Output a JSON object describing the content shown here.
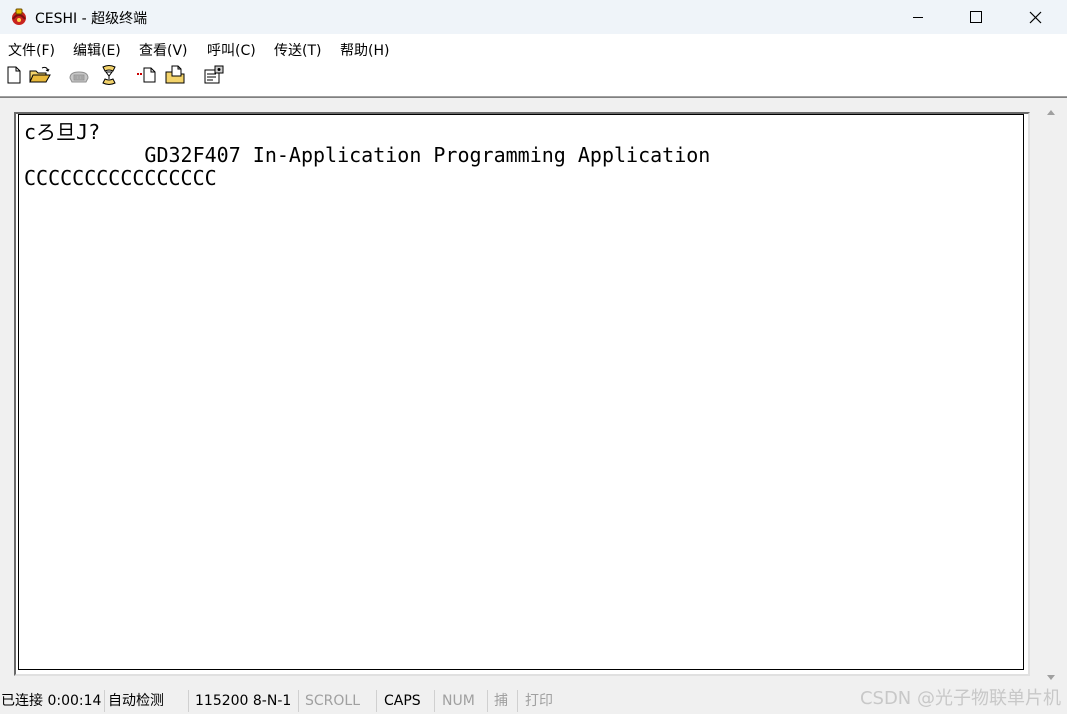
{
  "window": {
    "title": "CESHI - 超级终端"
  },
  "title_buttons": {
    "minimize": "minimize-icon",
    "maximize": "maximize-icon",
    "close": "close-icon"
  },
  "menu": {
    "items": [
      {
        "label": "文件(F)"
      },
      {
        "label": "编辑(E)"
      },
      {
        "label": "查看(V)"
      },
      {
        "label": "呼叫(C)"
      },
      {
        "label": "传送(T)"
      },
      {
        "label": "帮助(H)"
      }
    ]
  },
  "toolbar": {
    "buttons": [
      {
        "icon": "new-document-icon"
      },
      {
        "icon": "open-folder-icon"
      },
      {
        "icon": "call-phone-icon"
      },
      {
        "icon": "disconnect-icon"
      },
      {
        "icon": "send-file-icon"
      },
      {
        "icon": "receive-file-icon"
      },
      {
        "icon": "properties-icon"
      }
    ]
  },
  "terminal": {
    "lines": [
      "cろ旦J?",
      "          GD32F407 In-Application Programming Application",
      "CCCCCCCCCCCCCCCC"
    ]
  },
  "statusbar": {
    "connection": "已连接 0:00:14",
    "detect": "自动检测",
    "port_settings": "115200 8-N-1",
    "scroll": "SCROLL",
    "caps": "CAPS",
    "num": "NUM",
    "capture": "捕",
    "print": "打印"
  },
  "watermark": "CSDN @光子物联单片机",
  "colors": {
    "titlebar_bg": "#eff4f9",
    "terminal_bg": "#ffffff",
    "terminal_text": "#000000",
    "status_dim": "#a0a0a0"
  }
}
